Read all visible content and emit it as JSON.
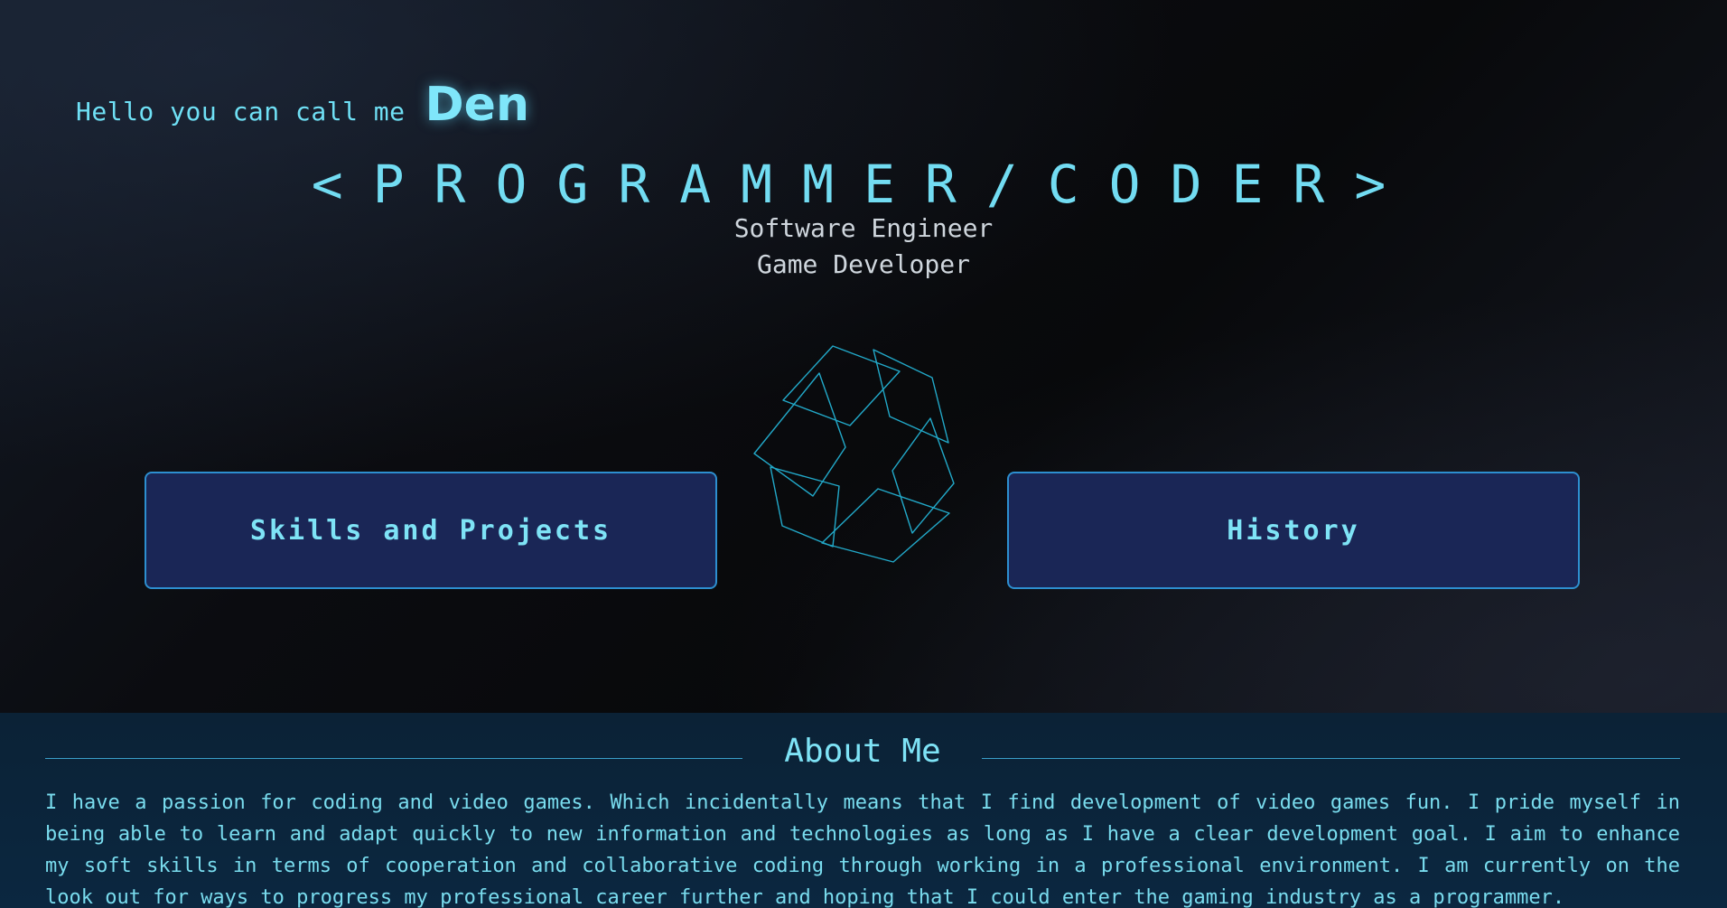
{
  "hero": {
    "greeting_prefix": "Hello you can call me",
    "greeting_name": "Den",
    "headline": "<PROGRAMMER/CODER>",
    "roles": [
      "Software Engineer",
      "Game Developer"
    ],
    "cube_icon": "wireframe-cube-icon"
  },
  "nav": {
    "skills_label": "Skills and Projects",
    "history_label": "History"
  },
  "about": {
    "title": "About Me",
    "body": "I have a passion for coding and video games. Which incidentally means that I find development of video games fun. I pride myself in being able to learn and adapt quickly to new information and technologies as long as I have a clear development goal. I aim to enhance my soft skills in terms of cooperation and collaborative coding through working in a professional environment. I am currently on the look out for ways to progress my professional career further and hoping that I could enter the gaming industry as a programmer."
  },
  "colors": {
    "accent": "#6fe0f5",
    "button_bg": "#1a2656",
    "button_border": "#2d8fd0",
    "about_bg": "#0b2236"
  }
}
